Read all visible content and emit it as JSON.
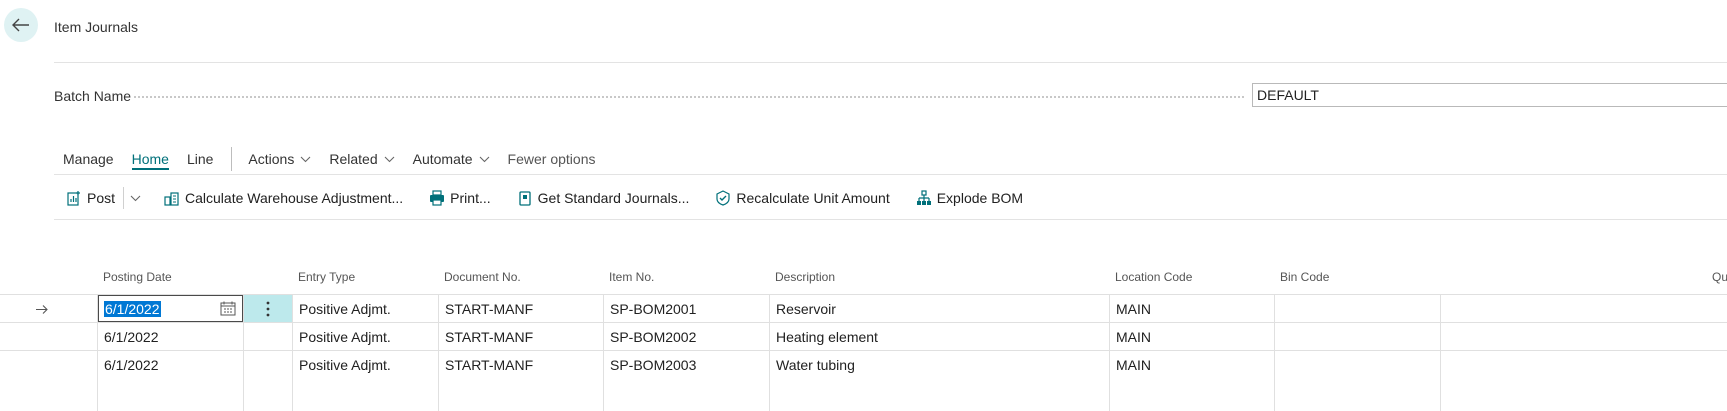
{
  "header": {
    "title": "Item Journals"
  },
  "batch": {
    "label": "Batch Name",
    "value": "DEFAULT"
  },
  "menu": {
    "items": [
      "Manage",
      "Home",
      "Line"
    ],
    "dropdowns": [
      "Actions",
      "Related",
      "Automate"
    ],
    "fewer": "Fewer options",
    "active": "Home"
  },
  "toolbar": {
    "post": "Post",
    "calc": "Calculate Warehouse Adjustment...",
    "print": "Print...",
    "standard": "Get Standard Journals...",
    "recalc": "Recalculate Unit Amount",
    "explode": "Explode BOM"
  },
  "columns": {
    "posting_date": "Posting Date",
    "entry_type": "Entry Type",
    "document_no": "Document No.",
    "item_no": "Item No.",
    "description": "Description",
    "location_code": "Location Code",
    "bin_code": "Bin Code",
    "qty": "Qu"
  },
  "rows": [
    {
      "posting_date": "6/1/2022",
      "entry_type": "Positive Adjmt.",
      "document_no": "START-MANF",
      "item_no": "SP-BOM2001",
      "description": "Reservoir",
      "location_code": "MAIN",
      "bin_code": ""
    },
    {
      "posting_date": "6/1/2022",
      "entry_type": "Positive Adjmt.",
      "document_no": "START-MANF",
      "item_no": "SP-BOM2002",
      "description": "Heating element",
      "location_code": "MAIN",
      "bin_code": ""
    },
    {
      "posting_date": "6/1/2022",
      "entry_type": "Positive Adjmt.",
      "document_no": "START-MANF",
      "item_no": "SP-BOM2003",
      "description": "Water tubing",
      "location_code": "MAIN",
      "bin_code": ""
    }
  ],
  "colors": {
    "accent": "#00707a",
    "selection": "#bde9ec"
  }
}
